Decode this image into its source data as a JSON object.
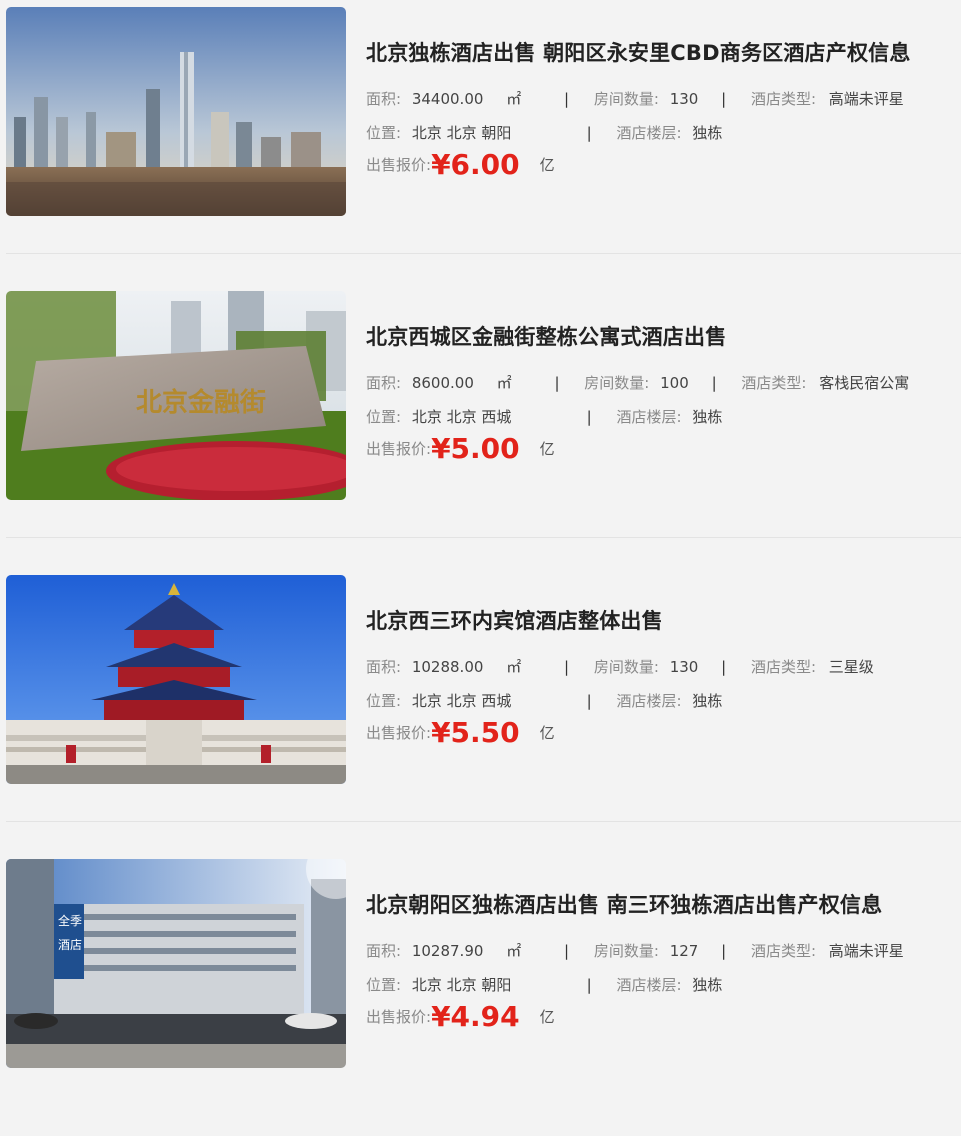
{
  "listings": [
    {
      "title": "北京独栋酒店出售 朝阳区永安里CBD商务区酒店产权信息",
      "area_label": "面积:",
      "area_value": "34400.00",
      "area_unit": "㎡",
      "rooms_label": "房间数量:",
      "rooms_value": "130",
      "type_label": "酒店类型:",
      "type_value": "高端未评星",
      "location_label": "位置:",
      "location_value": "北京 北京 朝阳",
      "floors_label": "酒店楼层:",
      "floors_value": "独栋",
      "price_label": "出售报价:",
      "price_value": "¥6.00",
      "price_unit": "亿",
      "image": "cbd-skyline-photo"
    },
    {
      "title": "北京西城区金融街整栋公寓式酒店出售",
      "area_label": "面积:",
      "area_value": "8600.00",
      "area_unit": "㎡",
      "rooms_label": "房间数量:",
      "rooms_value": "100",
      "type_label": "酒店类型:",
      "type_value": "客栈民宿公寓",
      "location_label": "位置:",
      "location_value": "北京 北京 西城",
      "floors_label": "酒店楼层:",
      "floors_value": "独栋",
      "price_label": "出售报价:",
      "price_value": "¥5.00",
      "price_unit": "亿",
      "image": "financial-street-stone-photo",
      "image_text": "北京金融街"
    },
    {
      "title": "北京西三环内宾馆酒店整体出售",
      "area_label": "面积:",
      "area_value": "10288.00",
      "area_unit": "㎡",
      "rooms_label": "房间数量:",
      "rooms_value": "130",
      "type_label": "酒店类型:",
      "type_value": "三星级",
      "location_label": "位置:",
      "location_value": "北京 北京 西城",
      "floors_label": "酒店楼层:",
      "floors_value": "独栋",
      "price_label": "出售报价:",
      "price_value": "¥5.50",
      "price_unit": "亿",
      "image": "temple-of-heaven-photo"
    },
    {
      "title": "北京朝阳区独栋酒店出售 南三环独栋酒店出售产权信息",
      "area_label": "面积:",
      "area_value": "10287.90",
      "area_unit": "㎡",
      "rooms_label": "房间数量:",
      "rooms_value": "127",
      "type_label": "酒店类型:",
      "type_value": "高端未评星",
      "location_label": "位置:",
      "location_value": "北京 北京 朝阳",
      "floors_label": "酒店楼层:",
      "floors_value": "独栋",
      "price_label": "出售报价:",
      "price_value": "¥4.94",
      "price_unit": "亿",
      "image": "ji-hotel-building-photo",
      "image_text": "全季酒店"
    }
  ],
  "colors": {
    "price": "#e2231a",
    "title": "#222222",
    "label": "#8a8a8a",
    "background": "#f3f3f3"
  }
}
